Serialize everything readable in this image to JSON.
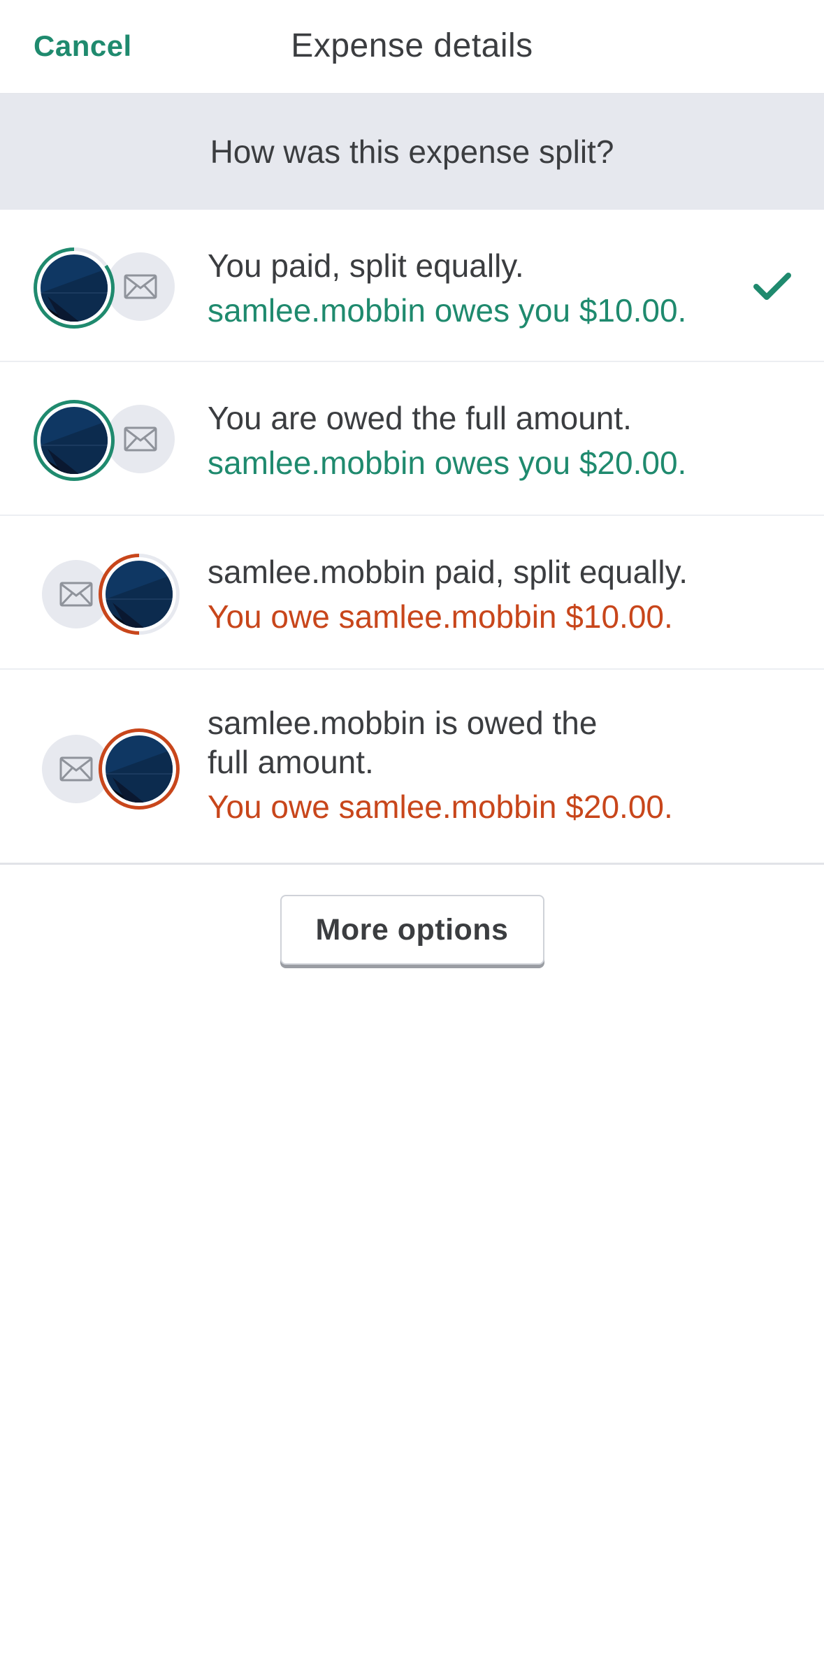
{
  "header": {
    "cancel_label": "Cancel",
    "title": "Expense details"
  },
  "question": "How was this expense split?",
  "options": [
    {
      "main": "You paid, split equally.",
      "sub": "samlee.mobbin owes you $10.00.",
      "selected": true
    },
    {
      "main": "You are owed the full amount.",
      "sub": "samlee.mobbin owes you $20.00.",
      "selected": false
    },
    {
      "main": "samlee.mobbin paid, split equally.",
      "sub": "You owe samlee.mobbin $10.00.",
      "selected": false
    },
    {
      "main_line1": "samlee.mobbin is owed the",
      "main_line2": "full amount.",
      "sub": "You owe samlee.mobbin $20.00.",
      "selected": false
    }
  ],
  "more_options_label": "More options",
  "colors": {
    "accent_green": "#1f8a6e",
    "accent_orange": "#c8461b",
    "question_bar_bg": "#e6e8ee"
  }
}
